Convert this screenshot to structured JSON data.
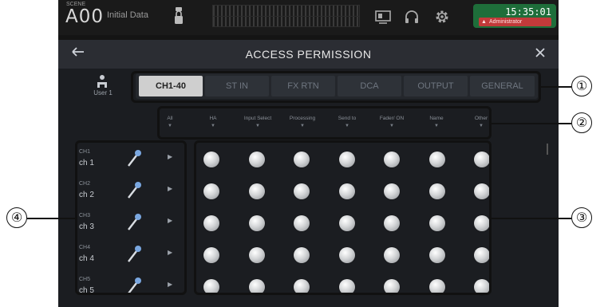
{
  "topbar": {
    "scene_tag": "SCENE",
    "scene_number": "A00",
    "scene_name": "Initial Data",
    "time": "15:35:01",
    "user": "Administrator"
  },
  "titlebar": {
    "title": "ACCESS PERMISSION",
    "back_icon": "back-arrow-icon",
    "close_icon": "close-icon"
  },
  "user_label": "User 1",
  "tabs": [
    {
      "label": "CH1-40",
      "active": true
    },
    {
      "label": "ST IN",
      "active": false
    },
    {
      "label": "FX RTN",
      "active": false
    },
    {
      "label": "DCA",
      "active": false
    },
    {
      "label": "OUTPUT",
      "active": false
    },
    {
      "label": "GENERAL",
      "active": false
    }
  ],
  "categories": [
    "All",
    "HA",
    "Input Select",
    "Processing",
    "Send to",
    "Fader/ ON",
    "Name",
    "Other"
  ],
  "channels": [
    {
      "number": "CH1",
      "name": "ch 1"
    },
    {
      "number": "CH2",
      "name": "ch 2"
    },
    {
      "number": "CH3",
      "name": "ch 3"
    },
    {
      "number": "CH4",
      "name": "ch 4"
    },
    {
      "number": "CH5",
      "name": "ch 5"
    }
  ],
  "permission_columns": 7,
  "callouts": [
    "①",
    "②",
    "③",
    "④"
  ],
  "colors": {
    "clock_bg": "#1e6e3a",
    "user_badge": "#c23a3a",
    "active_tab": "#cfcfcf"
  }
}
